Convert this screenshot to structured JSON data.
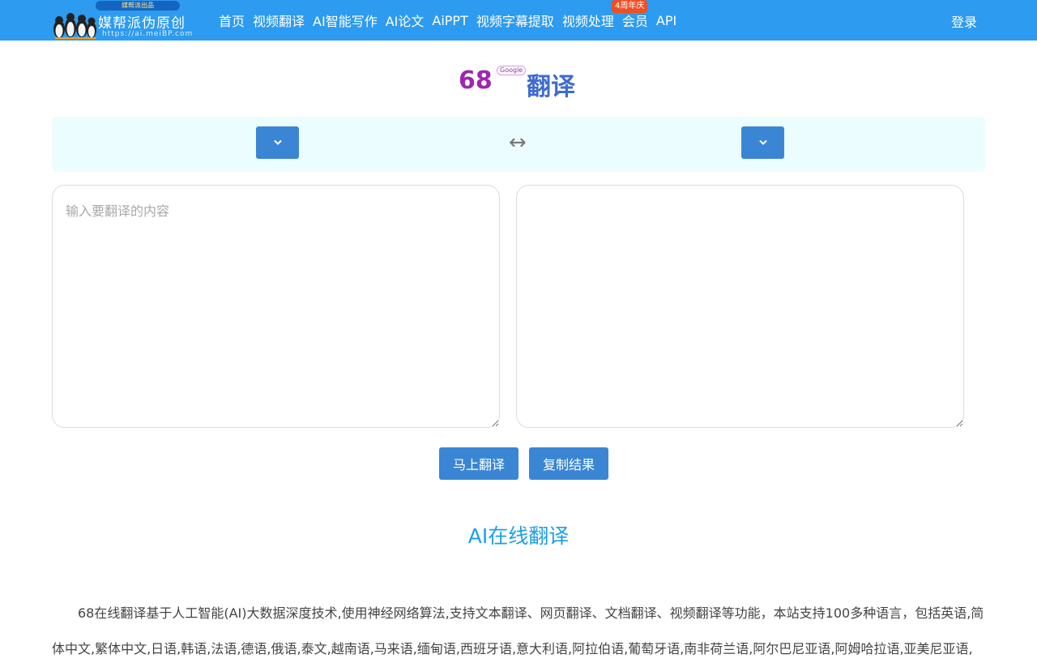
{
  "header": {
    "logo_badge": "媒帮派出品",
    "logo_name": "媒帮派伪原创",
    "logo_url": "https://ai.meiBP.com",
    "nav": [
      {
        "label": "首页"
      },
      {
        "label": "视频翻译"
      },
      {
        "label": "AI智能写作"
      },
      {
        "label": "AI论文"
      },
      {
        "label": "AiPPT"
      },
      {
        "label": "视频字幕提取"
      },
      {
        "label": "视频处理"
      },
      {
        "label": "会员"
      },
      {
        "label": "API"
      }
    ],
    "promo_badge": "4周年庆",
    "login_label": "登录",
    "colors": {
      "bar": "#2d9bf0",
      "promo": "#f04e23"
    }
  },
  "title": {
    "number": "68",
    "google_tag": "Google",
    "text": "翻译"
  },
  "lang_bar": {
    "swap_symbol": "↔",
    "from_icon": "chevron-down-icon",
    "to_icon": "chevron-down-icon"
  },
  "editor": {
    "source_placeholder": "输入要翻译的内容",
    "source_value": "",
    "result_value": ""
  },
  "actions": {
    "translate_label": "马上翻译",
    "copy_label": "复制结果",
    "accent": "#3a86d4"
  },
  "article": {
    "heading": "AI在线翻译",
    "paragraph": "68在线翻译基于人工智能(AI)大数据深度技术,使用神经网络算法,支持文本翻译、网页翻译、文档翻译、视频翻译等功能，本站支持100多种语言，包括英语,简体中文,繁体中文,日语,韩语,法语,德语,俄语,泰文,越南语,马来语,缅甸语,西班牙语,意大利语,阿拉伯语,葡萄牙语,南非荷兰语,阿尔巴尼亚语,阿姆哈拉语,亚美尼亚语,"
  }
}
